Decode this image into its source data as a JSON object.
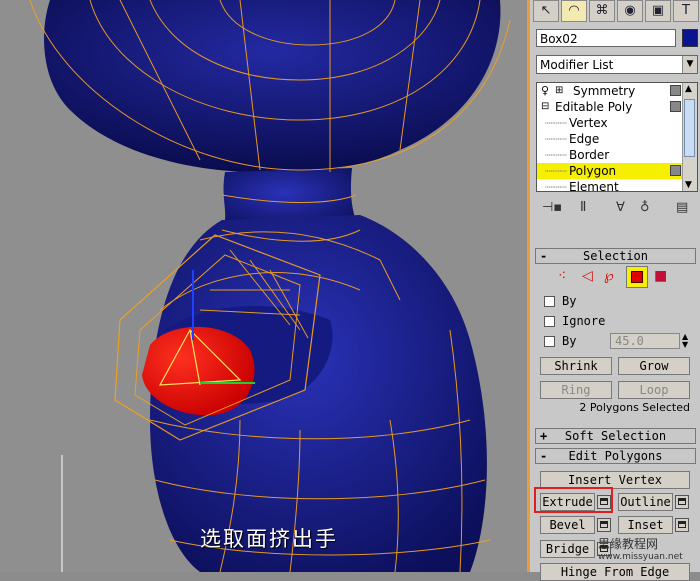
{
  "caption": "选取面挤出手",
  "toolbar": {
    "tabs": [
      {
        "icon": "create-arrow-icon",
        "glyph": "↖"
      },
      {
        "icon": "modify-icon",
        "glyph": "◠"
      },
      {
        "icon": "hierarchy-icon",
        "glyph": "⌘"
      },
      {
        "icon": "motion-icon",
        "glyph": "◉"
      },
      {
        "icon": "display-icon",
        "glyph": "▣"
      },
      {
        "icon": "utilities-icon",
        "glyph": "T"
      }
    ]
  },
  "object_name": "Box02",
  "object_color": "#0b148f",
  "modifier_list": "Modifier List",
  "stack": {
    "items": [
      {
        "label": "Symmetry",
        "type": "modifier"
      },
      {
        "label": "Editable Poly",
        "type": "base"
      },
      {
        "label": "Vertex",
        "type": "sub"
      },
      {
        "label": "Edge",
        "type": "sub"
      },
      {
        "label": "Border",
        "type": "sub"
      },
      {
        "label": "Polygon",
        "type": "sub",
        "selected": true
      },
      {
        "label": "Element",
        "type": "sub"
      }
    ]
  },
  "selection": {
    "title": "Selection",
    "sign": "-",
    "by_vertex": "By",
    "ignore": "Ignore",
    "by_angle": "By",
    "angle_value": "45.0",
    "shrink": "Shrink",
    "grow": "Grow",
    "ring": "Ring",
    "loop": "Loop",
    "status": "2 Polygons Selected"
  },
  "soft_selection": {
    "title": "Soft Selection",
    "sign": "+"
  },
  "edit_polygons": {
    "title": "Edit Polygons",
    "sign": "-",
    "insert_vertex": "Insert Vertex",
    "extrude": "Extrude",
    "outline": "Outline",
    "bevel": "Bevel",
    "inset": "Inset",
    "bridge": "Bridge",
    "hinge": "Hinge From Edge"
  },
  "colors": {
    "highlight": "#f6f000",
    "accent": "#e89c3a",
    "extrude_box": "#e02020",
    "model": "#1a1f8c",
    "wire": "#f0a020"
  },
  "watermark": {
    "line1": "思缘教程网",
    "line2": "www.missyuan.net"
  }
}
